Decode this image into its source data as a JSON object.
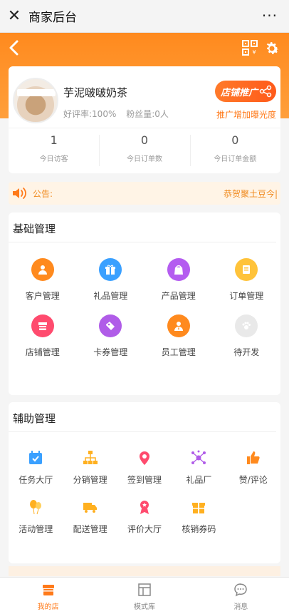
{
  "window": {
    "title": "商家后台",
    "more": "···",
    "close": "✕"
  },
  "header": {
    "icons": [
      "back-icon",
      "qr-code-icon",
      "gear-icon"
    ],
    "accent": "#ff8a1e"
  },
  "shop": {
    "name": "芋泥啵啵奶茶",
    "rating": "好评率:100%",
    "fans": "粉丝量:0人",
    "promo_button": "店铺推广",
    "promo_sub": "推广增加曝光度",
    "stats": [
      {
        "value": "1",
        "label": "今日访客"
      },
      {
        "value": "0",
        "label": "今日订单数"
      },
      {
        "value": "0",
        "label": "今日订单金额"
      }
    ]
  },
  "notice": {
    "label": "公告:",
    "text": "恭贺聚土豆今|"
  },
  "basic": {
    "title": "基础管理",
    "items": [
      {
        "label": "客户管理",
        "icon": "customer-icon",
        "color": "#ff8a1e"
      },
      {
        "label": "礼品管理",
        "icon": "gift-icon",
        "color": "#3aa0ff"
      },
      {
        "label": "产品管理",
        "icon": "product-icon",
        "color": "#b45cf0"
      },
      {
        "label": "订单管理",
        "icon": "order-icon",
        "color": "#ffc33a"
      },
      {
        "label": "店铺管理",
        "icon": "shop-icon",
        "color": "#ff4b6e"
      },
      {
        "label": "卡券管理",
        "icon": "coupon-icon",
        "color": "#b05ce8"
      },
      {
        "label": "员工管理",
        "icon": "staff-icon",
        "color": "#ff8a1e"
      },
      {
        "label": "待开发",
        "icon": "paw-icon",
        "color": "#eeeeee"
      }
    ]
  },
  "aux": {
    "title": "辅助管理",
    "items": [
      {
        "label": "任务大厅",
        "icon": "calendar-icon",
        "color": "#3aa0ff"
      },
      {
        "label": "分销管理",
        "icon": "hierarchy-icon",
        "color": "#ffb020"
      },
      {
        "label": "签到管理",
        "icon": "location-pin-icon",
        "color": "#ff4b6e"
      },
      {
        "label": "礼品厂",
        "icon": "network-icon",
        "color": "#b05ce8"
      },
      {
        "label": "赞/评论",
        "icon": "thumbs-up-icon",
        "color": "#ff8a1e"
      },
      {
        "label": "活动管理",
        "icon": "balloon-icon",
        "color": "#ffb020"
      },
      {
        "label": "配送管理",
        "icon": "truck-icon",
        "color": "#ffb020"
      },
      {
        "label": "评价大厅",
        "icon": "award-icon",
        "color": "#ff4b6e"
      },
      {
        "label": "核销券码",
        "icon": "gift-box-icon",
        "color": "#ffb020"
      }
    ]
  },
  "tabbar": [
    {
      "label": "我的店",
      "icon": "store-icon",
      "active": true
    },
    {
      "label": "模式库",
      "icon": "layout-icon",
      "active": false
    },
    {
      "label": "消息",
      "icon": "chat-icon",
      "active": false
    }
  ]
}
